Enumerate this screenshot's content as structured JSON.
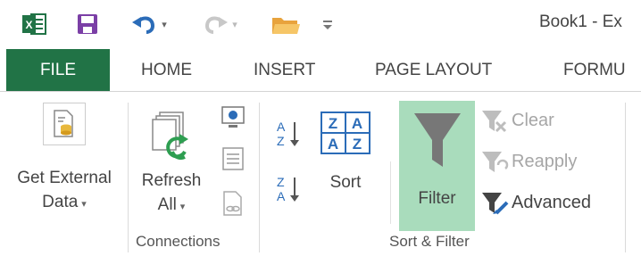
{
  "titlebar": {
    "title": "Book1 - Ex"
  },
  "tabs": [
    {
      "label": "FILE",
      "active": true
    },
    {
      "label": "HOME"
    },
    {
      "label": "INSERT"
    },
    {
      "label": "PAGE LAYOUT"
    },
    {
      "label": "FORMU"
    }
  ],
  "ribbon": {
    "get_external_data": {
      "line1": "Get External",
      "line2": "Data"
    },
    "connections_group": {
      "refresh_all": {
        "line1": "Refresh",
        "line2": "All"
      },
      "label": "Connections"
    },
    "sort_filter_group": {
      "sort_label": "Sort",
      "filter_label": "Filter",
      "clear_label": "Clear",
      "reapply_label": "Reapply",
      "advanced_label": "Advanced",
      "label": "Sort & Filter"
    }
  },
  "colors": {
    "file_tab": "#217346",
    "filter_active_bg": "#a9dcbc",
    "excel_green": "#217346",
    "save_purple": "#7b3fa6",
    "undo_blue": "#2b6cb8"
  }
}
